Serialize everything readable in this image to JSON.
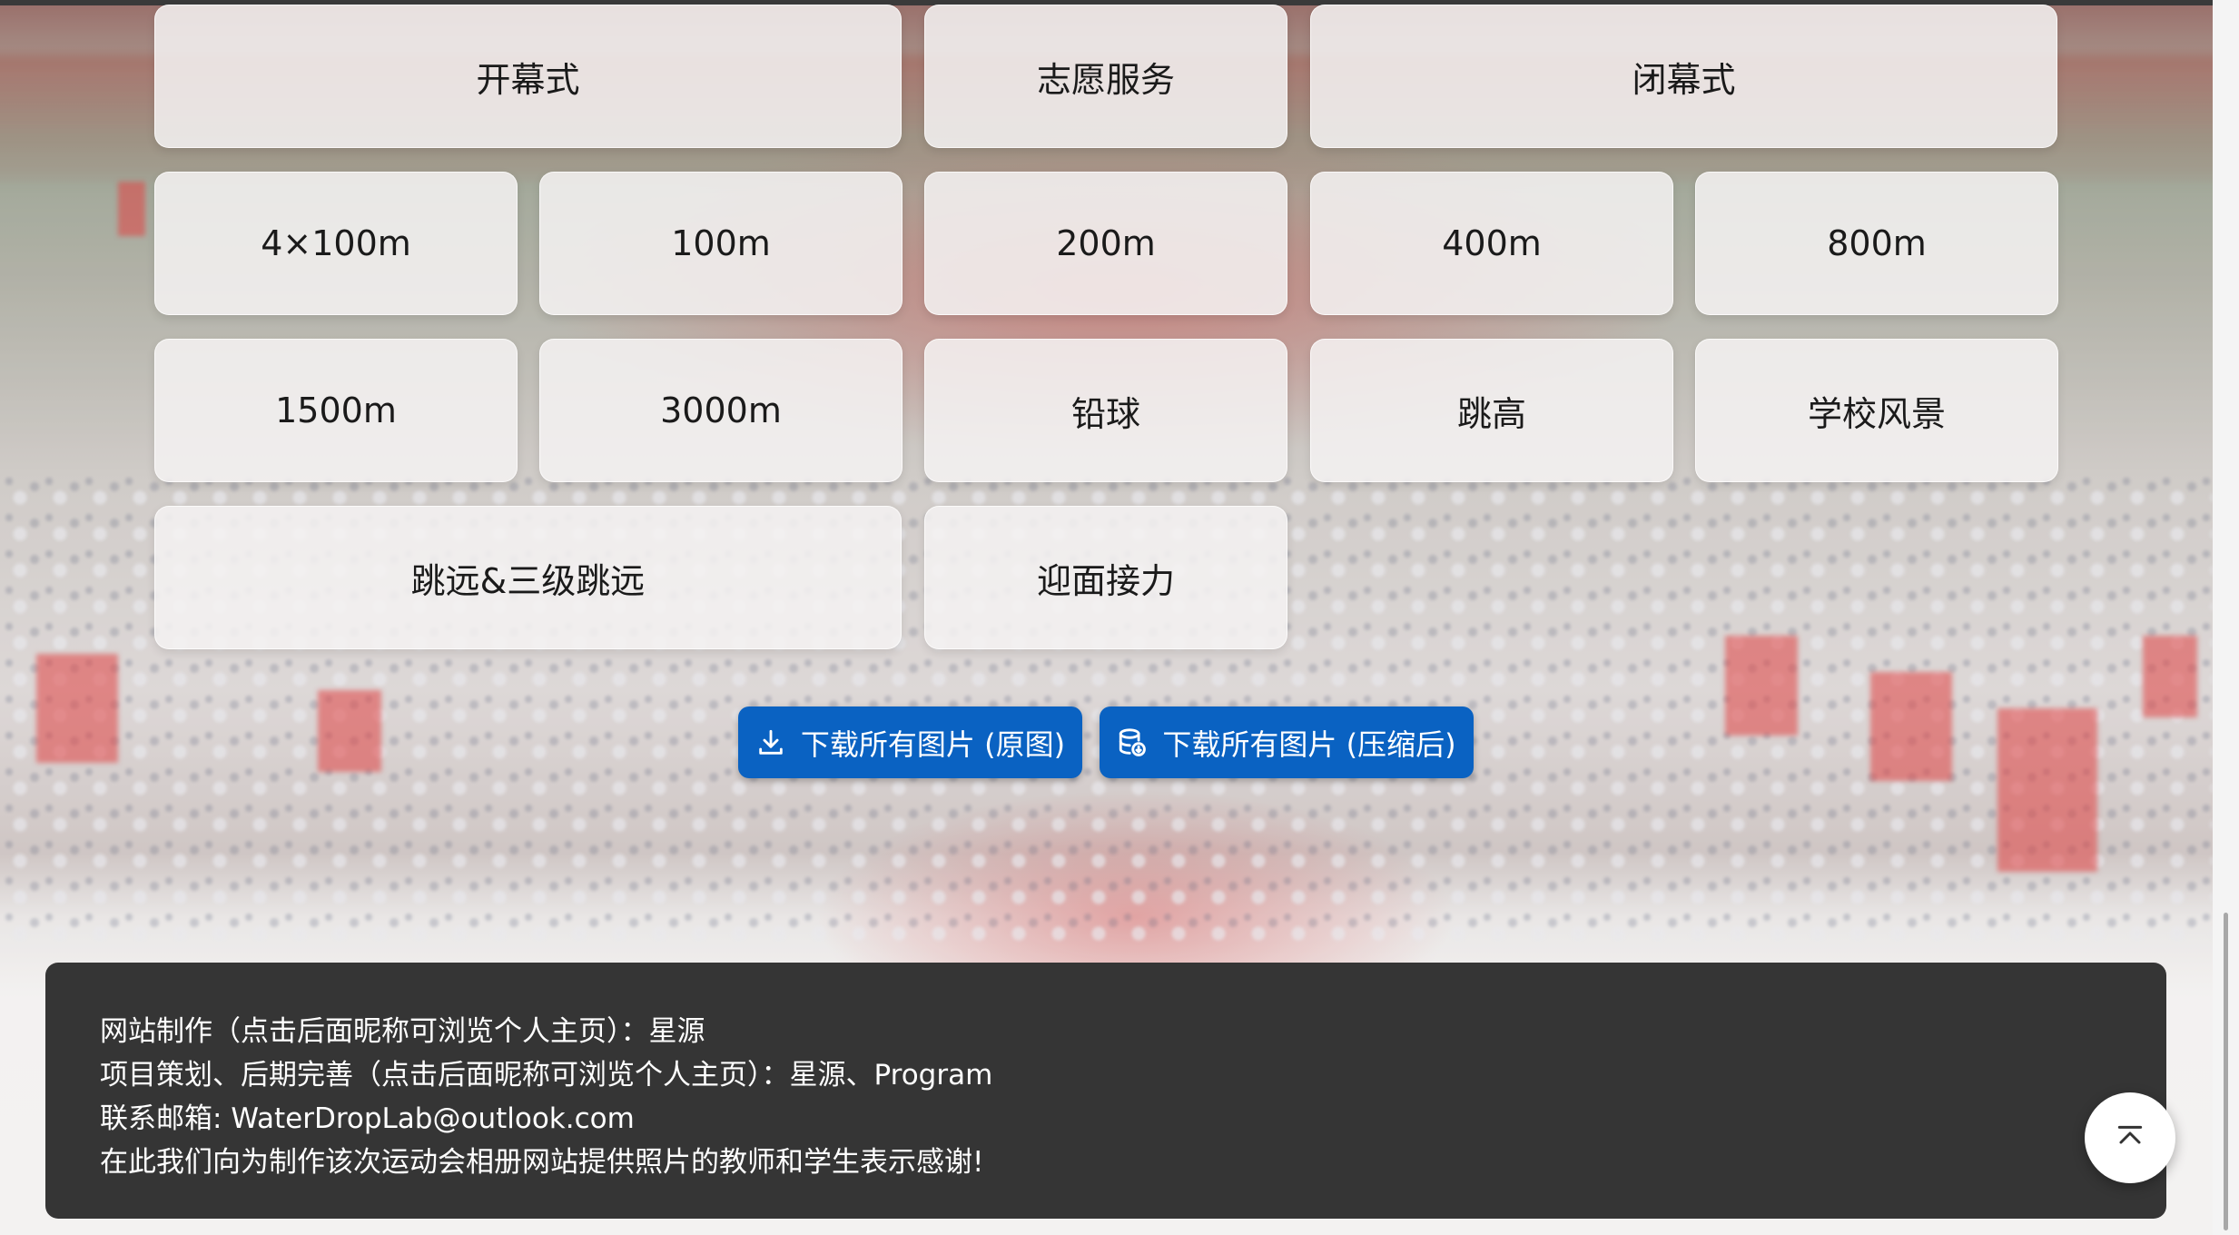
{
  "categories": [
    {
      "label": "开幕式"
    },
    {
      "label": "志愿服务"
    },
    {
      "label": "闭幕式"
    },
    {
      "label": "4×100m"
    },
    {
      "label": "100m"
    },
    {
      "label": "200m"
    },
    {
      "label": "400m"
    },
    {
      "label": "800m"
    },
    {
      "label": "1500m"
    },
    {
      "label": "3000m"
    },
    {
      "label": "铅球"
    },
    {
      "label": "跳高"
    },
    {
      "label": "学校风景"
    },
    {
      "label": "跳远&三级跳远"
    },
    {
      "label": "迎面接力"
    }
  ],
  "downloads": {
    "original_label": "下载所有图片 (原图)",
    "original_icon": "download-icon",
    "compressed_label": "下载所有图片 (压缩后)",
    "compressed_icon": "database-download-icon",
    "color": "#0a62c2"
  },
  "footer": {
    "line1_prefix": "网站制作（点击后面昵称可浏览个人主页）：",
    "line1_name": "星源",
    "line2_prefix": "项目策划、后期完善（点击后面昵称可浏览个人主页）：",
    "line2_name1": "星源",
    "line2_sep": "、",
    "line2_name2": "Program",
    "line3_prefix": "联系邮箱:",
    "line3_email": "WaterDropLab@outlook.com",
    "line4": "在此我们向为制作该次运动会相册网站提供照片的教师和学生表示感谢!",
    "background": "#353535"
  },
  "back_to_top": {
    "icon": "arrow-up-to-top-icon"
  }
}
